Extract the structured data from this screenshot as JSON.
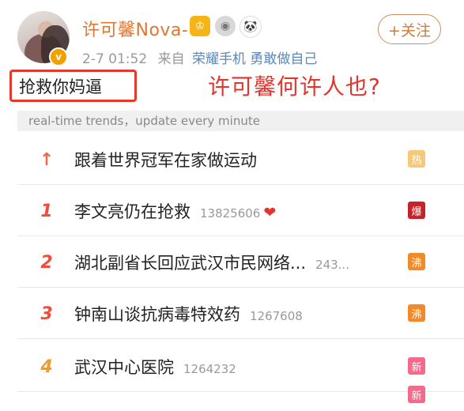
{
  "header": {
    "username": "许可馨Nova-",
    "timestamp": "2-7 01:52",
    "source_prefix": "来自",
    "source": "荣耀手机 勇敢做自己",
    "follow_label": "+关注",
    "verify_glyph": "v",
    "badges": [
      {
        "name": "crown-badge-icon",
        "glyph": "♔"
      },
      {
        "name": "medal-badge-icon",
        "glyph": "◉"
      },
      {
        "name": "panda-badge-icon",
        "glyph": "🐼"
      }
    ]
  },
  "post": {
    "comment_text": "抢救你妈逼",
    "caption": "许可馨何许人也?"
  },
  "trends": {
    "strip_text": "real-time trends，update every minute",
    "items": [
      {
        "rank": "↑",
        "topic": "跟着世界冠军在家做运动",
        "count": "",
        "tag": "热",
        "tag_type": "hot"
      },
      {
        "rank": "1",
        "topic": "李文亮仍在抢救",
        "count": "13825606",
        "heart": "❤",
        "tag": "爆",
        "tag_type": "boom"
      },
      {
        "rank": "2",
        "topic": "湖北副省长回应武汉市民网络...",
        "count": "243...",
        "tag": "沸",
        "tag_type": "boil"
      },
      {
        "rank": "3",
        "topic": "钟南山谈抗病毒特效药",
        "count": "1267608",
        "tag": "沸",
        "tag_type": "boil"
      },
      {
        "rank": "4",
        "topic": "武汉中心医院",
        "count": "1264232",
        "tag": "新",
        "tag_type": "new"
      }
    ],
    "extra_tag": "新"
  },
  "colors": {
    "username": "#e1762f",
    "caption": "#e8332c",
    "box_border": "#e23b2e",
    "link": "#5b88b6"
  }
}
